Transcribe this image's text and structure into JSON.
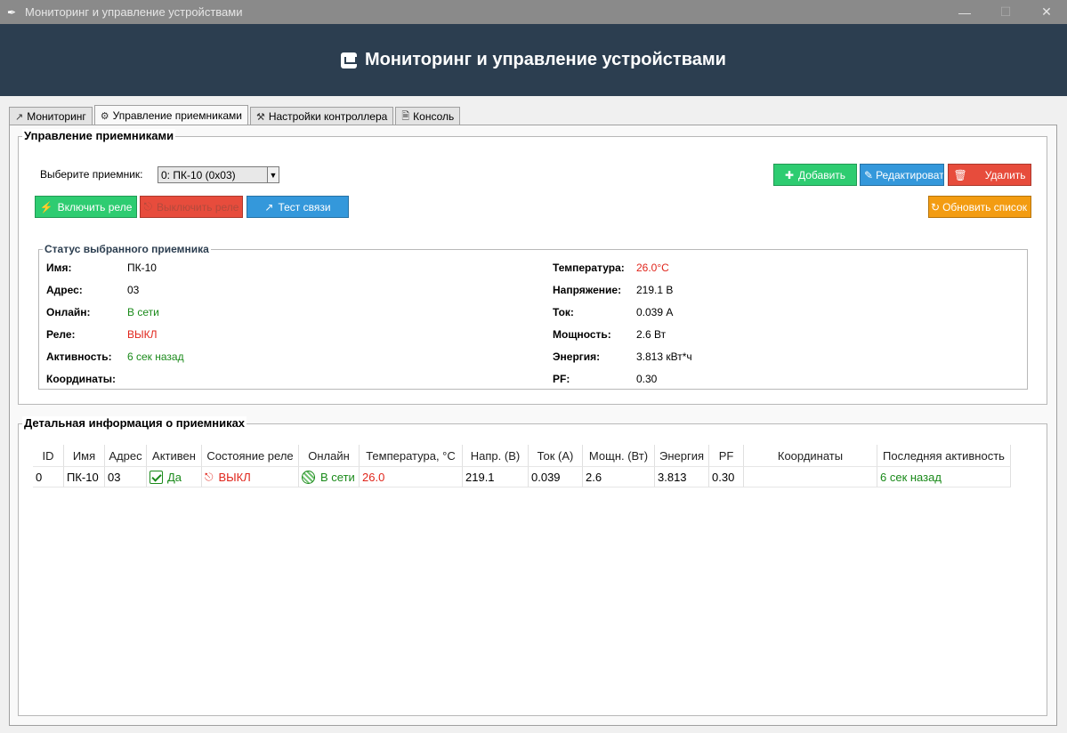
{
  "window": {
    "title": "Мониторинг и управление устройствами"
  },
  "header": {
    "title": "Мониторинг и управление устройствами"
  },
  "tabs": [
    {
      "label": "Мониторинг"
    },
    {
      "label": "Управление приемниками"
    },
    {
      "label": "Настройки контроллера"
    },
    {
      "label": "Консоль"
    }
  ],
  "receivers_group": {
    "title": "Управление приемниками",
    "select_label": "Выберите приемник:",
    "selected_receiver": "0: ПК-10 (0x03)",
    "buttons": {
      "add": "Добавить",
      "edit": "Редактироват",
      "delete": "Удалить",
      "relay_on": "Включить реле",
      "relay_off": "Выключить реле",
      "test": "Тест связи",
      "refresh": "Обновить список"
    }
  },
  "status": {
    "title": "Статус выбранного приемника",
    "left": [
      {
        "key": "Имя:",
        "value": "ПК-10"
      },
      {
        "key": "Адрес:",
        "value": "03"
      },
      {
        "key": "Онлайн:",
        "value": "В сети"
      },
      {
        "key": "Реле:",
        "value": "ВЫКЛ"
      },
      {
        "key": "Активность:",
        "value": "6 сек назад"
      },
      {
        "key": "Координаты:",
        "value": ""
      }
    ],
    "right": [
      {
        "key": "Температура:",
        "value": "26.0°C"
      },
      {
        "key": "Напряжение:",
        "value": "219.1 В"
      },
      {
        "key": "Ток:",
        "value": "0.039 А"
      },
      {
        "key": "Мощность:",
        "value": "2.6 Вт"
      },
      {
        "key": "Энергия:",
        "value": "3.813 кВт*ч"
      },
      {
        "key": "PF:",
        "value": "0.30"
      }
    ]
  },
  "details": {
    "title": "Детальная информация о приемниках",
    "columns": [
      "ID",
      "Имя",
      "Адрес",
      "Активен",
      "Состояние реле",
      "Онлайн",
      "Температура, °C",
      "Напр. (В)",
      "Ток (А)",
      "Мощн. (Вт)",
      "Энергия",
      "PF",
      "Координаты",
      "Последняя активность"
    ],
    "rows": [
      {
        "id": "0",
        "name": "ПК-10",
        "address": "03",
        "active": "Да",
        "relay": "ВЫКЛ",
        "online": "В сети",
        "temperature": "26.0",
        "voltage": "219.1",
        "current": "0.039",
        "power": "2.6",
        "energy": "3.813",
        "pf": "0.30",
        "coordinates": "",
        "last_activity": "6 сек назад"
      }
    ]
  },
  "colors": {
    "header_bg": "#2c3e50",
    "green_button": "#2ecc71",
    "red_button": "#e74c3c",
    "blue_button": "#3498db",
    "orange_button": "#f39c12",
    "status_green": "#1a8a1a",
    "status_red": "#e0251b"
  }
}
